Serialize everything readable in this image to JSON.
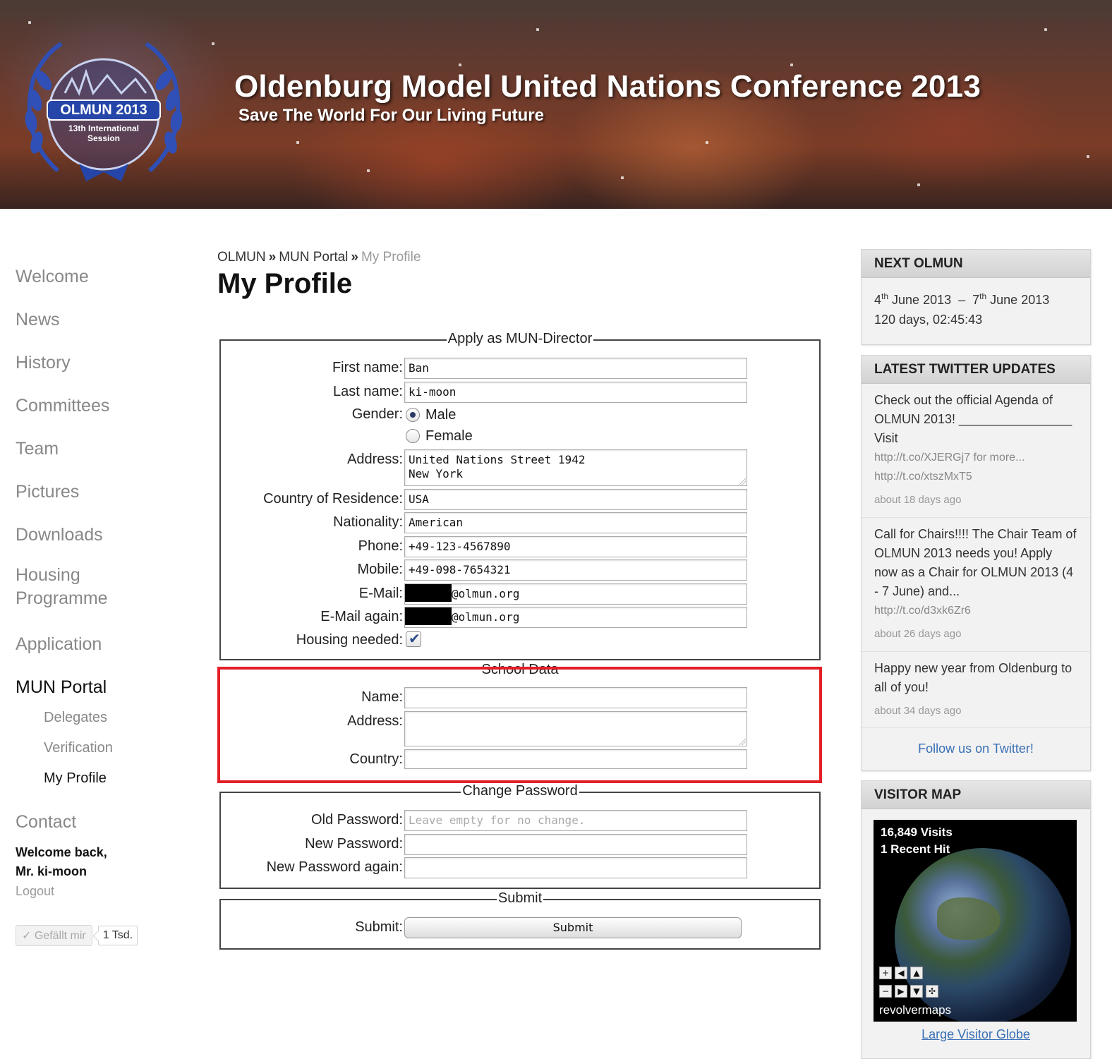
{
  "banner": {
    "title": "Oldenburg Model United Nations Conference 2013",
    "subtitle": "Save The World For Our Living Future",
    "logo_text": "OLMUN 2013",
    "logo_sub1": "13th International",
    "logo_sub2": "Session"
  },
  "nav": {
    "items": [
      "Welcome",
      "News",
      "History",
      "Committees",
      "Team",
      "Pictures",
      "Downloads"
    ],
    "housing_line1": "Housing",
    "housing_line2": "Programme",
    "application": "Application",
    "portal": "MUN Portal",
    "sub_items": [
      "Delegates",
      "Verification",
      "My Profile"
    ],
    "contact": "Contact",
    "welcome_line1": "Welcome back,",
    "welcome_line2": "Mr. ki-moon",
    "logout": "Logout",
    "like_label": "✓ Gefällt mir",
    "like_count": "1 Tsd."
  },
  "breadcrumb": {
    "root": "OLMUN",
    "sep": "»",
    "portal": "MUN Portal",
    "current": "My Profile"
  },
  "page_title": "My Profile",
  "director": {
    "legend": "Apply as MUN-Director",
    "first_name_label": "First name:",
    "first_name": "Ban",
    "last_name_label": "Last name:",
    "last_name": "ki-moon",
    "gender_label": "Gender:",
    "gender_male": "Male",
    "gender_female": "Female",
    "address_label": "Address:",
    "address_line1": "United Nations Street 1942",
    "address_line2": "New York",
    "country_label": "Country of Residence:",
    "country": "USA",
    "nationality_label": "Nationality:",
    "nationality": "American",
    "phone_label": "Phone:",
    "phone": "+49-123-4567890",
    "mobile_label": "Mobile:",
    "mobile": "+49-098-7654321",
    "email_label": "E-Mail:",
    "email_domain": "@olmun.org",
    "email_again_label": "E-Mail again:",
    "email_again_domain": "@olmun.org",
    "housing_label": "Housing needed:"
  },
  "school": {
    "legend": "School Data",
    "name_label": "Name:",
    "address_label": "Address:",
    "country_label": "Country:"
  },
  "password": {
    "legend": "Change Password",
    "old_label": "Old Password:",
    "old_placeholder": "Leave empty for no change.",
    "new_label": "New Password:",
    "new_again_label": "New Password again:"
  },
  "submit": {
    "legend": "Submit",
    "label": "Submit:",
    "button": "Submit"
  },
  "sidebar": {
    "next_head": "NEXT OLMUN",
    "next_date": "4th June 2013 – 7th June 2013",
    "countdown": "120 days, 02:45:43",
    "twitter_head": "LATEST TWITTER UPDATES",
    "tweets": [
      {
        "text": "Check out the official Agenda of OLMUN 2013! ________________ Visit",
        "link1": "http://t.co/XJERGj7 for more...",
        "link2": "http://t.co/xtszMxT5",
        "ago": "about 18 days ago"
      },
      {
        "text": "Call for Chairs!!!! The Chair Team of OLMUN 2013 needs you! Apply now as a Chair for OLMUN 2013 (4 - 7 June) and...",
        "link1": "http://t.co/d3xk6Zr6",
        "ago": "about 26 days ago"
      },
      {
        "text": "Happy new year from Oldenburg to all of you!",
        "ago": "about 34 days ago"
      }
    ],
    "follow": "Follow us on Twitter!",
    "map_head": "VISITOR MAP",
    "visits": "16,849 Visits",
    "recent": "1 Recent Hit",
    "map_brand": "revolvermaps",
    "globe_link": "Large Visitor Globe"
  },
  "colors": {
    "highlight": "#e32027",
    "link": "#3a6fb5"
  }
}
